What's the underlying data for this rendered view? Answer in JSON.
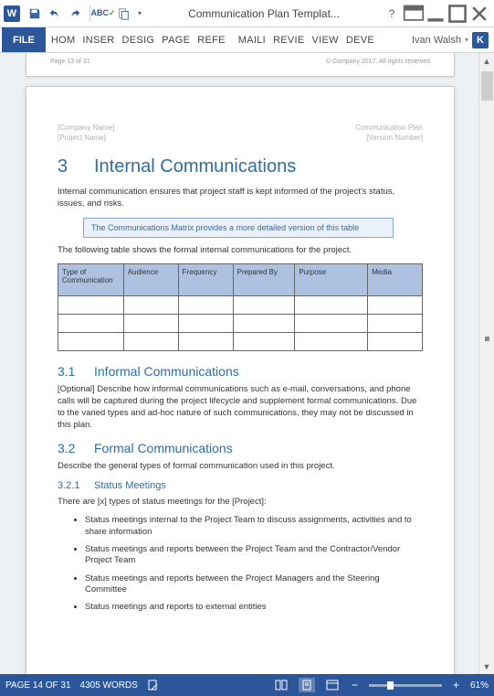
{
  "titlebar": {
    "app_icon_letter": "W",
    "document_title": "Communication Plan Templat..."
  },
  "ribbon": {
    "file": "FILE",
    "tabs": [
      "HOM",
      "INSER",
      "DESIG",
      "PAGE",
      "REFE",
      "MAILI",
      "REVIE",
      "VIEW",
      "DEVE"
    ],
    "user_name": "Ivan Walsh",
    "user_initial": "K"
  },
  "prev_page": {
    "page_label": "Page 13 of 31",
    "copyright": "© Company 2017. All rights reserved"
  },
  "doc": {
    "header": {
      "company": "[Company Name]",
      "plan": "Communication Plan",
      "project": "[Project Name]",
      "version": "[Version Number]"
    },
    "h1_num": "3",
    "h1_text": "Internal Communications",
    "intro": "Internal communication ensures that project staff is kept informed of the project's status, issues, and risks.",
    "callout": "The Communications Matrix provides a more detailed version of this table",
    "table_intro": "The following table shows the formal internal communications for the project.",
    "table_headers": [
      "Type of Communication",
      "Audience",
      "Frequency",
      "Prepared By",
      "Purpose",
      "Media"
    ],
    "h2a_num": "3.1",
    "h2a_text": "Informal Communications",
    "p31": "[Optional] Describe how informal communications such as e-mail, conversations, and phone calls will be captured during the project lifecycle and supplement formal communications. Due to the varied types and ad-hoc nature of such communications, they may not be discussed in this plan.",
    "h2b_num": "3.2",
    "h2b_text": "Formal Communications",
    "p32": "Describe the general types of formal communication used in this project.",
    "h3_num": "3.2.1",
    "h3_text": "Status Meetings",
    "p321": "There are [x] types of status meetings for the [Project]:",
    "bullets": [
      "Status meetings internal to the Project Team to discuss assignments, activities and to share information",
      "Status meetings and reports between the Project Team and the Contractor/Vendor Project Team",
      "Status meetings and reports between the Project Managers and the Steering Committee",
      "Status meetings and reports to external entities"
    ]
  },
  "status": {
    "page": "PAGE 14 OF 31",
    "words": "4305 WORDS",
    "zoom": "61%"
  }
}
